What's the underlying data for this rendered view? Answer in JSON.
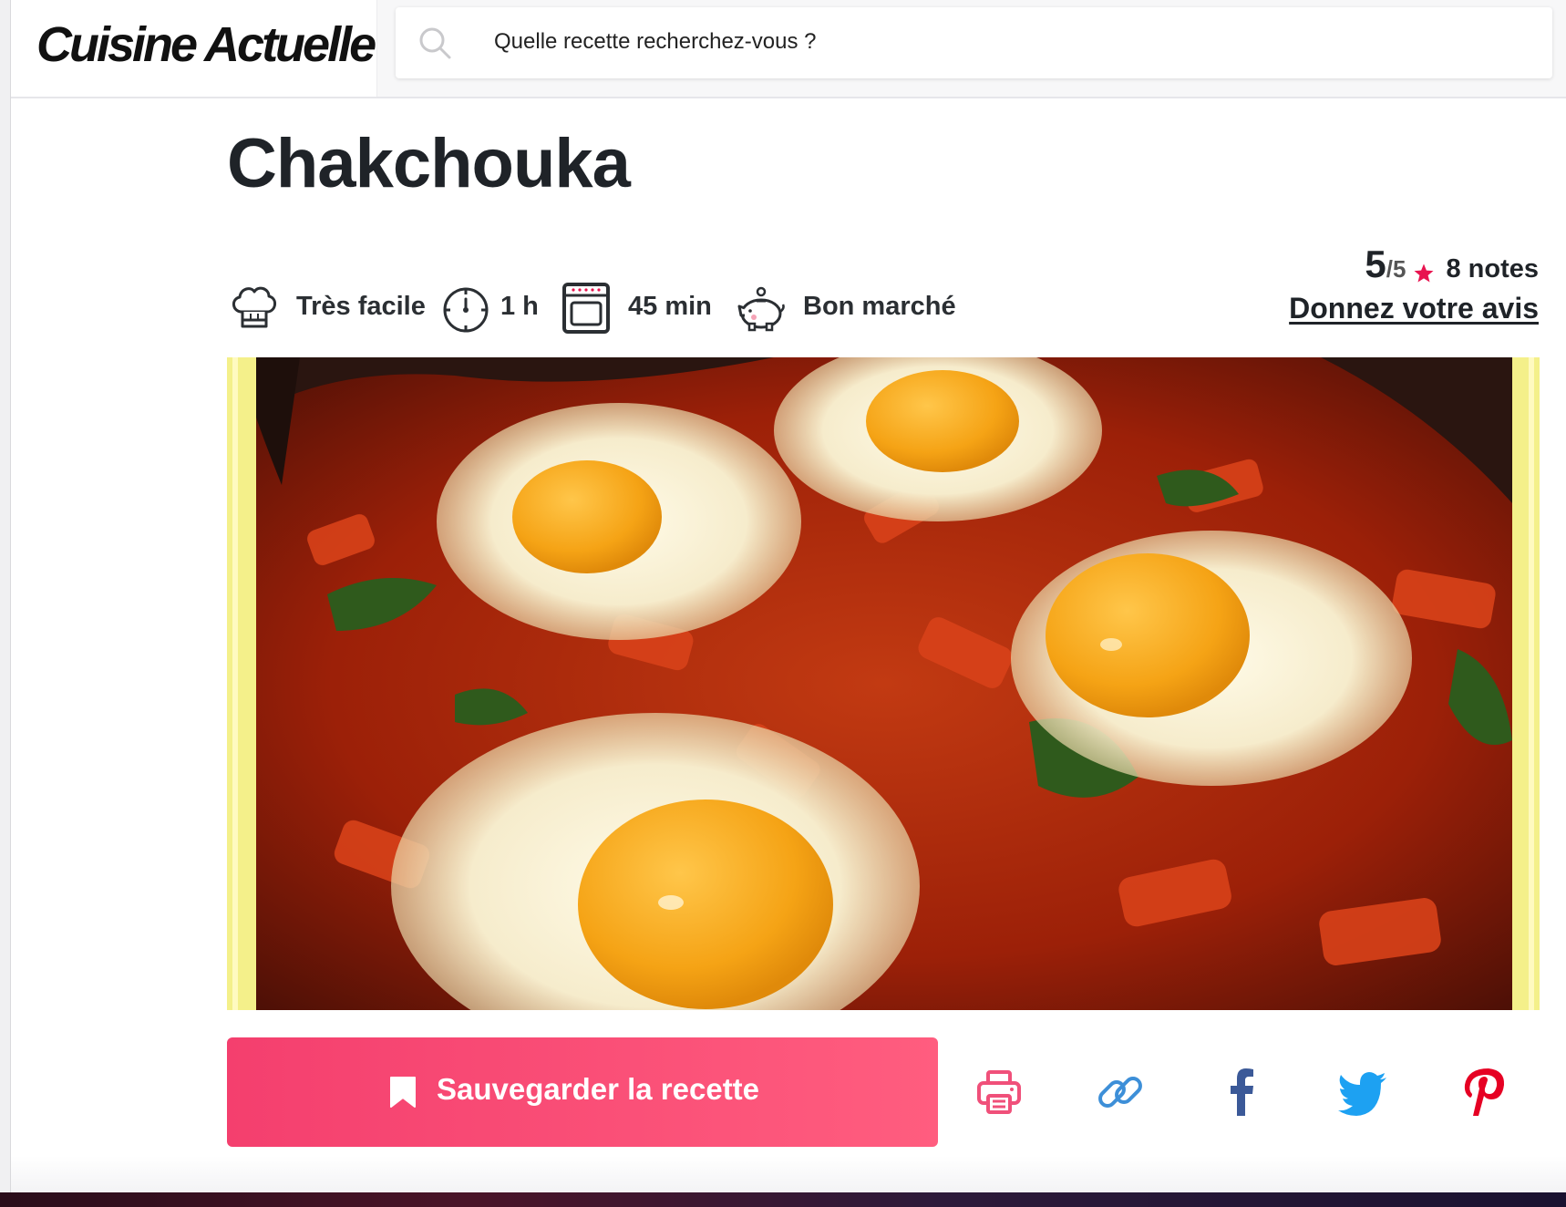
{
  "header": {
    "logo_text": "Cuisine Actuelle",
    "search": {
      "placeholder": "Quelle recette recherchez-vous ?",
      "icon": "search-icon"
    }
  },
  "recipe": {
    "title": "Chakchouka",
    "meta": [
      {
        "icon": "chef-hat-icon",
        "label": "Très facile"
      },
      {
        "icon": "timer-icon",
        "label": "1 h"
      },
      {
        "icon": "oven-icon",
        "label": "45 min"
      },
      {
        "icon": "piggy-bank-icon",
        "label": "Bon marché"
      }
    ],
    "rating": {
      "value": "5",
      "max": "/5",
      "count": "8 notes",
      "review_link": "Donnez votre avis",
      "star_color": "#e8144f"
    },
    "photo": {
      "description_icon": "recipe-photo"
    },
    "actions": {
      "save_label": "Sauvegarder la recette",
      "save_icon": "bookmark-icon",
      "share": [
        {
          "icon": "print-icon",
          "color": "#f0507a"
        },
        {
          "icon": "link-icon",
          "color": "#3d8fd8"
        },
        {
          "icon": "facebook-icon",
          "color": "#3b5998"
        },
        {
          "icon": "twitter-icon",
          "color": "#1da1f2"
        },
        {
          "icon": "pinterest-icon",
          "color": "#e60023"
        }
      ]
    }
  },
  "colors": {
    "accent": "#f43f6e",
    "text": "#1f2328"
  }
}
